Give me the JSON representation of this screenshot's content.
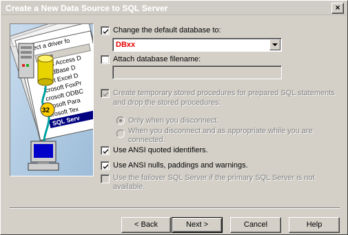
{
  "window": {
    "title": "Create a New Data Source to SQL Server",
    "close_glyph": "×"
  },
  "illustration": {
    "select_driver_text": "Select a driver fo",
    "name_header": "Name",
    "drivers": [
      "rosoft Access D",
      "soft dBase D",
      "osoft Excel D",
      "icrosoft FoxPr",
      "crosoft ODBC",
      "crosoft Para",
      "crosoft Tex",
      "SQL Serv"
    ],
    "badge": "32",
    "icons": [
      "server-icon",
      "database-cylinder-icon",
      "computer-icon"
    ]
  },
  "options": {
    "change_default_db": {
      "label": "Change the default database to:",
      "checked": true
    },
    "database_value": "DBxx",
    "attach_filename": {
      "label": "Attach database filename:",
      "checked": false
    },
    "temp_procs": {
      "label_line1": "Create temporary stored procedures for prepared SQL statements",
      "label_line2": "and drop the stored procedures:",
      "checked": true,
      "disabled": true
    },
    "radio_disconnect": {
      "label": "Only when you disconnect."
    },
    "radio_disconnect_appropriate": {
      "label_line1": "When you disconnect and as appropriate while you are",
      "label_line2": "connected."
    },
    "ansi_quoted": {
      "label": "Use ANSI quoted identifiers.",
      "checked": true
    },
    "ansi_nulls": {
      "label": "Use ANSI nulls, paddings and warnings.",
      "checked": true
    },
    "failover": {
      "label_line1": "Use the failover SQL Server if the primary SQL Server is not",
      "label_line2": "available.",
      "checked": false,
      "disabled": true
    }
  },
  "buttons": {
    "back": "< Back",
    "next": "Next >",
    "cancel": "Cancel",
    "help": "Help"
  },
  "colors": {
    "dialog_bg": "#d4d0c8",
    "value_red": "#e40000",
    "illustration_bg": "#bcd4ea",
    "selection_blue": "#000080"
  }
}
